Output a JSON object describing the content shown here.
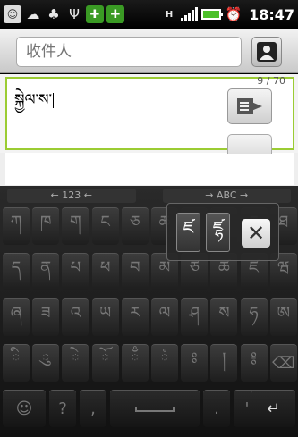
{
  "status_bar": {
    "time": "18:47",
    "network": "H",
    "icons": [
      "app-icon",
      "chat-icon",
      "android-icon",
      "usb-icon",
      "shield-icon",
      "shield-icon",
      "signal-icon",
      "battery-icon",
      "alarm-icon"
    ]
  },
  "compose": {
    "recipient_placeholder": "收件人",
    "message_text": "སྐྱེལ་ས་",
    "char_counter": "9 / 70"
  },
  "keyboard": {
    "mode_left": "← 123 ←",
    "mode_right": "→ ABC →",
    "rows": [
      [
        "ཀ",
        "ཁ",
        "ག",
        "ང",
        "ཅ",
        "ཆ",
        "ཇ",
        "ཉ",
        "ཏ",
        "ཐ"
      ],
      [
        "ད",
        "ན",
        "པ",
        "ཕ",
        "བ",
        "མ",
        "ཙ",
        "ཚ",
        "ཛ",
        "ཝ"
      ],
      [
        "ཞ",
        "ཟ",
        "འ",
        "ཡ",
        "ར",
        "ལ",
        "ཤ",
        "ས",
        "ཧ",
        "ཨ"
      ],
      [
        "ི",
        "ུ",
        "ེ",
        "ོ",
        "ྃ",
        "ཾ",
        "ཿ",
        "།",
        "༔",
        "⌫"
      ],
      [
        "☺",
        "?",
        ",",
        "space",
        ".",
        "'",
        "↵"
      ]
    ],
    "popup": {
      "chars": [
        "ཛ",
        "ཛྷ"
      ],
      "close_label": "✕"
    }
  }
}
